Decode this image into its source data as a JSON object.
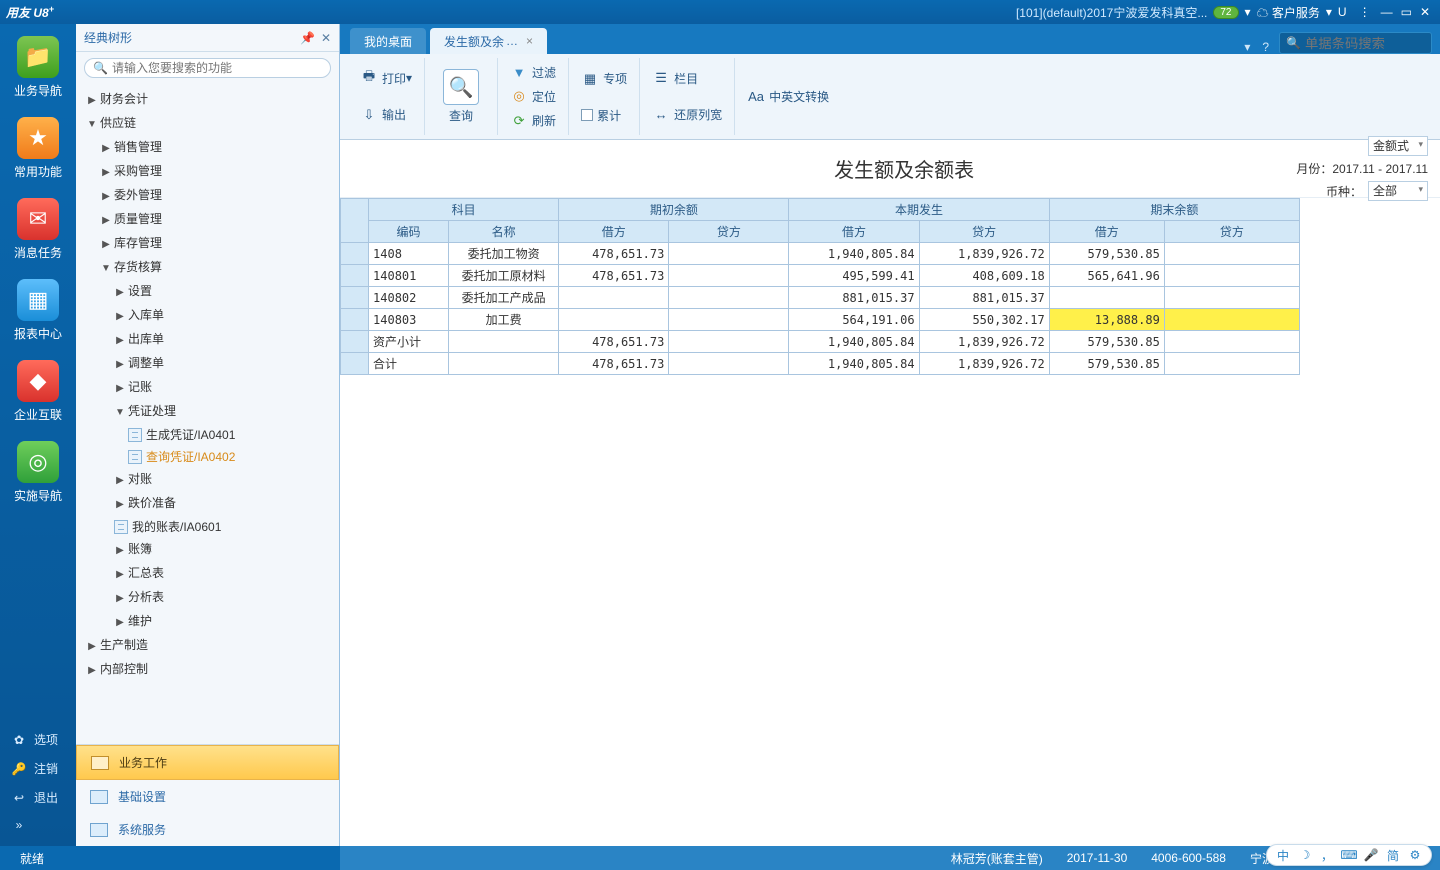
{
  "titlebar": {
    "app_name": "用友",
    "app_suffix": "U8",
    "plus": "+",
    "node_info": "[101](default)2017宁波爱发科真空...",
    "badge": "72",
    "service_label": "客户服务",
    "u_label": "U"
  },
  "rail": {
    "items": [
      {
        "label": "业务导航",
        "icon": "📁"
      },
      {
        "label": "常用功能",
        "icon": "★"
      },
      {
        "label": "消息任务",
        "icon": "✉"
      },
      {
        "label": "报表中心",
        "icon": "▦"
      },
      {
        "label": "企业互联",
        "icon": "◆"
      },
      {
        "label": "实施导航",
        "icon": "◎"
      }
    ],
    "bottom": [
      {
        "label": "选项",
        "icon": "✿"
      },
      {
        "label": "注销",
        "icon": "🔑"
      },
      {
        "label": "退出",
        "icon": "↩"
      }
    ],
    "arrow": "»"
  },
  "nav": {
    "title": "经典树形",
    "search_placeholder": "请输入您要搜索的功能",
    "tree": {
      "finance": "财务会计",
      "supply": "供应链",
      "children": {
        "sale": "销售管理",
        "purchase": "采购管理",
        "outsrc": "委外管理",
        "quality": "质量管理",
        "stock": "库存管理",
        "inv": "存货核算",
        "inv_children": {
          "setup": "设置",
          "in": "入库单",
          "out": "出库单",
          "adjust": "调整单",
          "post": "记账",
          "voucher": "凭证处理",
          "voucher_children": {
            "gen": "生成凭证/IA0401",
            "query": "查询凭证/IA0402"
          },
          "recon": "对账",
          "deval": "跌价准备",
          "myrpt": "我的账表/IA0601",
          "book": "账簿",
          "summary": "汇总表",
          "analysis": "分析表",
          "maintain": "维护"
        }
      },
      "mfg": "生产制造",
      "internal": "内部控制"
    },
    "bottom": {
      "biz": "业务工作",
      "basic": "基础设置",
      "sys": "系统服务"
    }
  },
  "tabs": {
    "desktop": "我的桌面",
    "report": "发生额及余",
    "report_dots": "…",
    "search_placeholder": "单据条码搜索"
  },
  "ribbon": {
    "print": "打印",
    "export": "输出",
    "query": "查询",
    "filter": "过滤",
    "locate": "定位",
    "refresh": "刷新",
    "special": "专项",
    "cumulative": "累计",
    "columns": "栏目",
    "restore": "还原列宽",
    "cn_en": "中英文转换"
  },
  "report": {
    "title": "发生额及余额表",
    "period_label": "月份：",
    "period_value": "2017.11 - 2017.11",
    "style_label": "金额式",
    "currency_label": "币种：",
    "currency_value": "全部",
    "headers": {
      "subject": "科目",
      "code": "编码",
      "name": "名称",
      "open": "期初余额",
      "current": "本期发生",
      "end": "期末余额",
      "debit": "借方",
      "credit": "贷方"
    },
    "rows": [
      {
        "code": "1408",
        "name": "委托加工物资",
        "open_d": "478,651.73",
        "open_c": "",
        "cur_d": "1,940,805.84",
        "cur_c": "1,839,926.72",
        "end_d": "579,530.85",
        "end_c": "",
        "hl": false
      },
      {
        "code": "140801",
        "name": "委托加工原材料",
        "open_d": "478,651.73",
        "open_c": "",
        "cur_d": "495,599.41",
        "cur_c": "408,609.18",
        "end_d": "565,641.96",
        "end_c": "",
        "hl": false
      },
      {
        "code": "140802",
        "name": "委托加工产成品",
        "open_d": "",
        "open_c": "",
        "cur_d": "881,015.37",
        "cur_c": "881,015.37",
        "end_d": "",
        "end_c": "",
        "hl": false
      },
      {
        "code": "140803",
        "name": "加工费",
        "open_d": "",
        "open_c": "",
        "cur_d": "564,191.06",
        "cur_c": "550,302.17",
        "end_d": "13,888.89",
        "end_c": "",
        "hl": true
      },
      {
        "code": "资产小计",
        "name": "",
        "open_d": "478,651.73",
        "open_c": "",
        "cur_d": "1,940,805.84",
        "cur_c": "1,839,926.72",
        "end_d": "579,530.85",
        "end_c": "",
        "hl": false
      },
      {
        "code": "合计",
        "name": "",
        "open_d": "478,651.73",
        "open_c": "",
        "cur_d": "1,940,805.84",
        "cur_c": "1,839,926.72",
        "end_d": "579,530.85",
        "end_c": "",
        "hl": false
      }
    ]
  },
  "status": {
    "ready": "就绪",
    "user": "林冠芳(账套主管)",
    "date": "2017-11-30",
    "hotline": "4006-600-588",
    "company": "宁波爱发科真空技术有限公司"
  },
  "dock": {
    "cn": "中",
    "simp": "简"
  }
}
